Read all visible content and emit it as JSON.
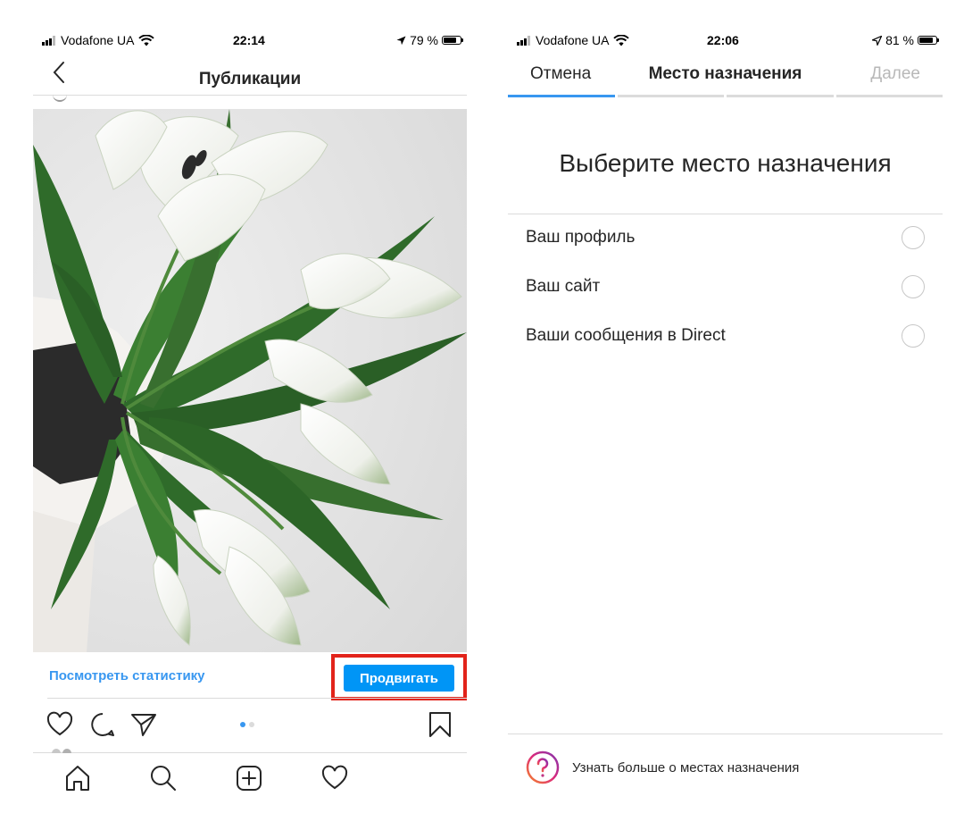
{
  "left": {
    "status": {
      "carrier": "Vodafone UA",
      "time": "22:14",
      "battery": "79 %",
      "battery_level": 0.79
    },
    "header": {
      "title": "Публикации"
    },
    "actions": {
      "stats_link": "Посмотреть статистику",
      "promote_label": "Продвигать"
    },
    "carousel": {
      "pages": 2,
      "active": 1
    }
  },
  "right": {
    "status": {
      "carrier": "Vodafone UA",
      "time": "22:06",
      "battery": "81 %",
      "battery_level": 0.81
    },
    "nav": {
      "cancel": "Отмена",
      "title": "Место назначения",
      "next": "Далее"
    },
    "progress_steps": 4,
    "progress_done": 1,
    "heading": "Выберите место назначения",
    "options": [
      {
        "label": "Ваш профиль"
      },
      {
        "label": "Ваш сайт"
      },
      {
        "label": "Ваши сообщения в Direct"
      }
    ],
    "learn_more": "Узнать больше о местах назначения"
  },
  "colors": {
    "accent": "#3897f0",
    "button": "#0095f6",
    "highlight": "#e2231a",
    "disabled": "#b8b8b8"
  },
  "icons": [
    "back-icon",
    "heart-icon",
    "comment-icon",
    "share-icon",
    "bookmark-icon",
    "home-icon",
    "search-icon",
    "add-icon",
    "activity-icon",
    "help-icon"
  ]
}
